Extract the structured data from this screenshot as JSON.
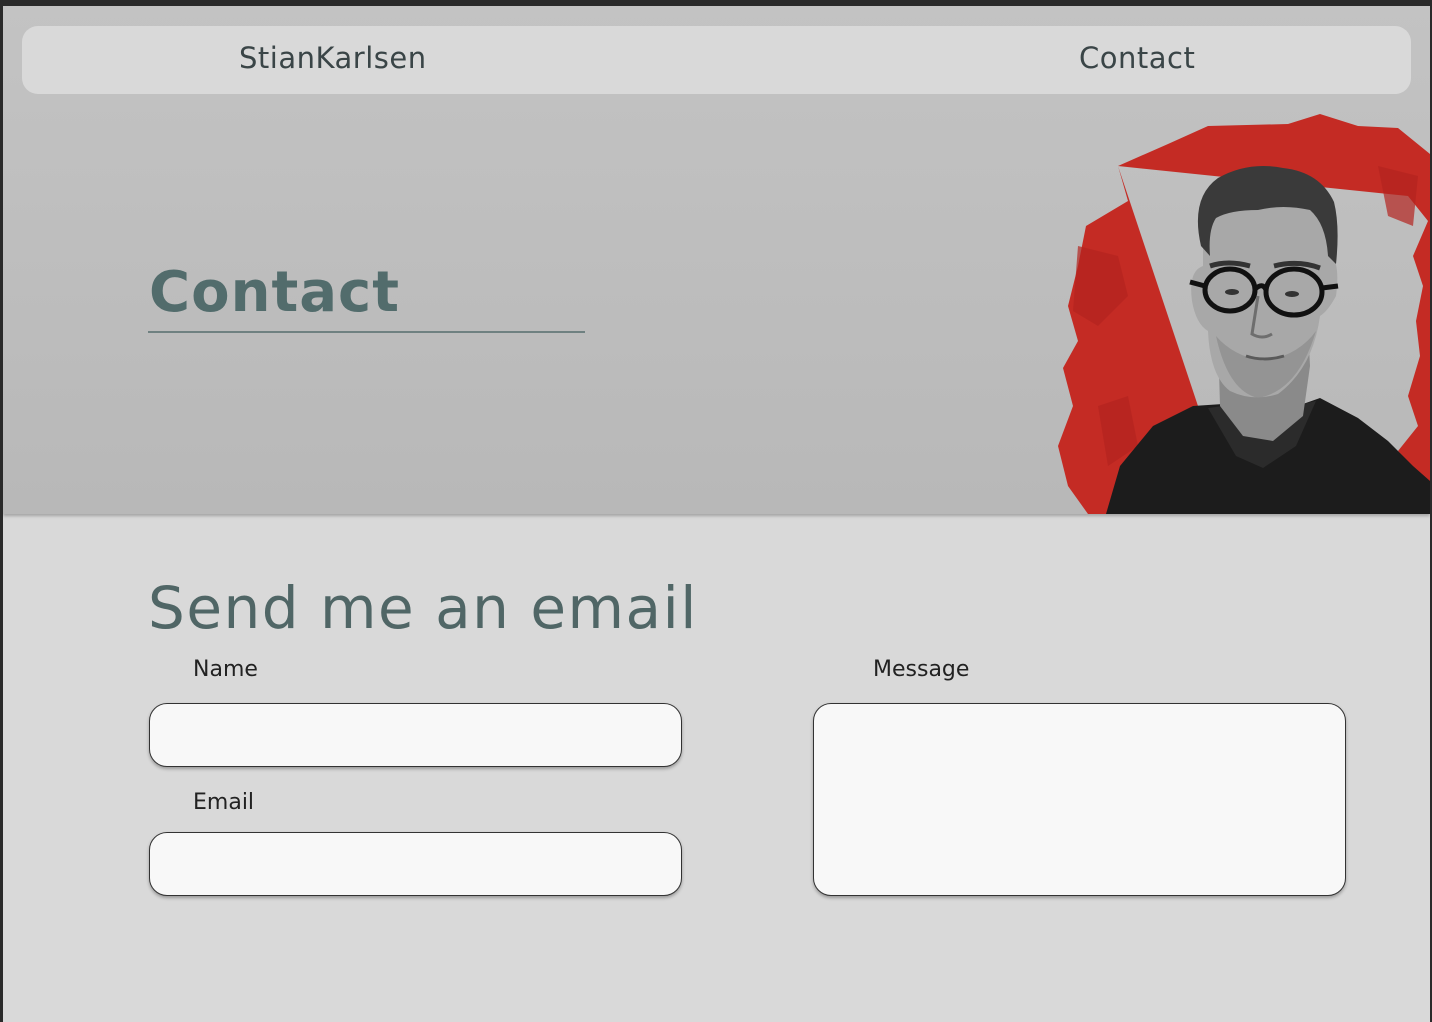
{
  "nav": {
    "brand": "StianKarlsen",
    "contact_link": "Contact"
  },
  "hero": {
    "title": "Contact",
    "portrait_alt": "portrait photo"
  },
  "form": {
    "title": "Send me an email",
    "name_label": "Name",
    "name_value": "",
    "email_label": "Email",
    "email_value": "",
    "message_label": "Message",
    "message_value": ""
  },
  "colors": {
    "accent_red": "#c42b24",
    "heading": "#526c6c",
    "navbar_bg": "#d9d9d9",
    "hero_bg": "#bdbdbd"
  }
}
